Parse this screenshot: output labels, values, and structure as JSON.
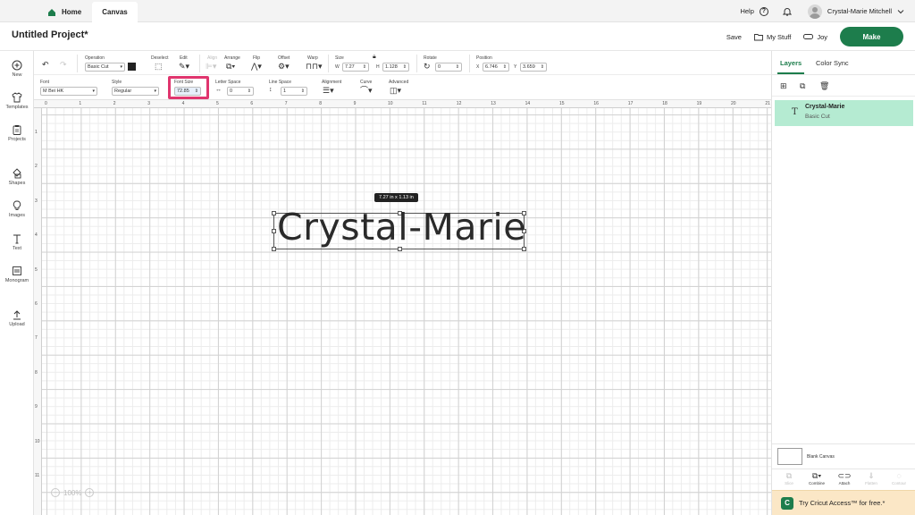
{
  "topbar": {
    "home_tab": "Home",
    "canvas_tab": "Canvas",
    "help": "Help",
    "user_name": "Crystal-Marie Mitchell"
  },
  "project": {
    "title": "Untitled Project*",
    "save": "Save",
    "my_stuff": "My Stuff",
    "joy": "Joy",
    "make": "Make"
  },
  "sidebar": {
    "items": [
      {
        "label": "New",
        "icon": "plus-circle-icon"
      },
      {
        "label": "Templates",
        "icon": "shirt-icon"
      },
      {
        "label": "Projects",
        "icon": "clipboard-icon"
      },
      {
        "label": "Shapes",
        "icon": "shapes-icon"
      },
      {
        "label": "Images",
        "icon": "bulb-icon"
      },
      {
        "label": "Text",
        "icon": "text-icon"
      },
      {
        "label": "Monogram",
        "icon": "monogram-icon"
      },
      {
        "label": "Upload",
        "icon": "upload-icon"
      }
    ]
  },
  "toolbar1": {
    "operation_label": "Operation",
    "operation_value": "Basic Cut",
    "operation_color": "#222222",
    "deselect_label": "Deselect",
    "edit_label": "Edit",
    "align_label": "Align",
    "arrange_label": "Arrange",
    "flip_label": "Flip",
    "offset_label": "Offset",
    "warp_label": "Warp",
    "size_label": "Size",
    "size_w_label": "W",
    "size_w": "7.27",
    "size_h_label": "H",
    "size_h": "1.128",
    "rotate_label": "Rotate",
    "rotate_value": "0",
    "position_label": "Position",
    "pos_x_label": "X",
    "pos_x": "6.746",
    "pos_y_label": "Y",
    "pos_y": "3.659"
  },
  "toolbar2": {
    "font_label": "Font",
    "font_value": "M Bei HK",
    "style_label": "Style",
    "style_value": "Regular",
    "font_size_label": "Font Size",
    "font_size_value": "72.85",
    "letter_space_label": "Letter Space",
    "letter_space_value": "0",
    "line_space_label": "Line Space",
    "line_space_value": "1",
    "alignment_label": "Alignment",
    "curve_label": "Curve",
    "advanced_label": "Advanced"
  },
  "canvas": {
    "text": "Crystal-Marie",
    "dimensions": "7.27  in x 1.13  in",
    "zoom": "100%",
    "ruler_top": [
      "0",
      "1",
      "2",
      "3",
      "4",
      "5",
      "6",
      "7",
      "8",
      "9",
      "10",
      "11",
      "12",
      "13",
      "14",
      "15",
      "16",
      "17",
      "18",
      "19",
      "20",
      "21"
    ],
    "ruler_left": [
      "1",
      "2",
      "3",
      "4",
      "5",
      "6",
      "7",
      "8",
      "9",
      "10",
      "11"
    ]
  },
  "right_panel": {
    "tab_layers": "Layers",
    "tab_color_sync": "Color Sync",
    "layer_name": "Crystal-Marie",
    "layer_sub": "Basic Cut",
    "blank_canvas": "Blank Canvas",
    "tools": [
      "Slice",
      "Combine",
      "Attach",
      "Flatten",
      "Contour"
    ],
    "access_banner": "Try Cricut Access™ for free.*",
    "accent_color": "#1d7d4c",
    "selected_layer_color": "#b5ebd2",
    "banner_color": "#fbe7c6"
  }
}
